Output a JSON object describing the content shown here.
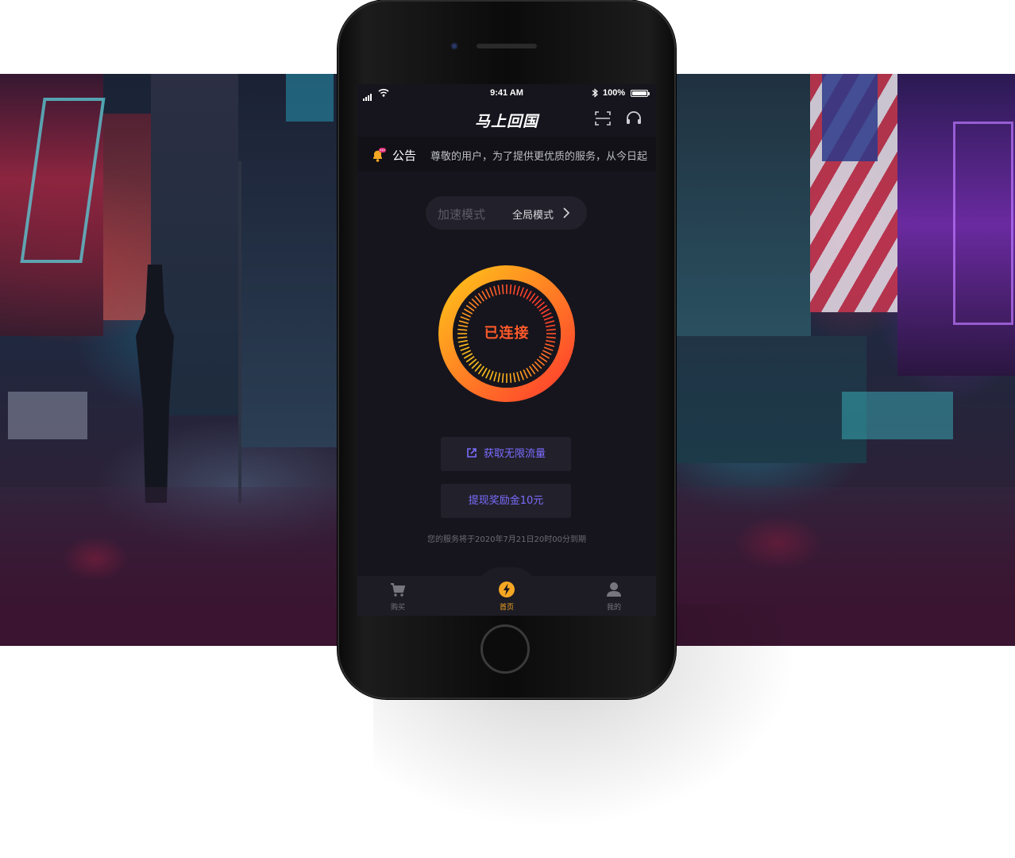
{
  "status_bar": {
    "time": "9:41 AM",
    "battery": "100%",
    "bluetooth_icon": "bluetooth-icon",
    "wifi_icon": "wifi-icon",
    "signal_icon": "cellular-signal-icon"
  },
  "nav": {
    "title": "马上回国",
    "scan_icon": "scan-icon",
    "support_icon": "headset-icon"
  },
  "notice": {
    "icon": "bell-icon",
    "label": "公告",
    "text": "尊敬的用户，为了提供更优质的服务，从今日起"
  },
  "mode": {
    "label": "加速模式",
    "value": "全局模式",
    "chevron_icon": "chevron-right-icon"
  },
  "connection": {
    "status": "已连接",
    "colors": {
      "start": "#ffc21a",
      "end": "#ff3d2e"
    }
  },
  "actions": {
    "unlimited_traffic": "获取无限流量",
    "withdraw_bonus": "提现奖励金10元",
    "link_icon": "external-link-icon"
  },
  "expiry_text": "您的服务将于2020年7月21日20时00分到期",
  "tabs": [
    {
      "label": "购买",
      "icon": "cart-icon",
      "active": false
    },
    {
      "label": "首页",
      "icon": "lightning-icon",
      "active": true
    },
    {
      "label": "我的",
      "icon": "user-icon",
      "active": false
    }
  ],
  "theme": {
    "screen_bg": "#16151d",
    "accent_purple": "#7b6cff",
    "accent_orange": "#f5a623",
    "status_red": "#ff5a2a"
  }
}
